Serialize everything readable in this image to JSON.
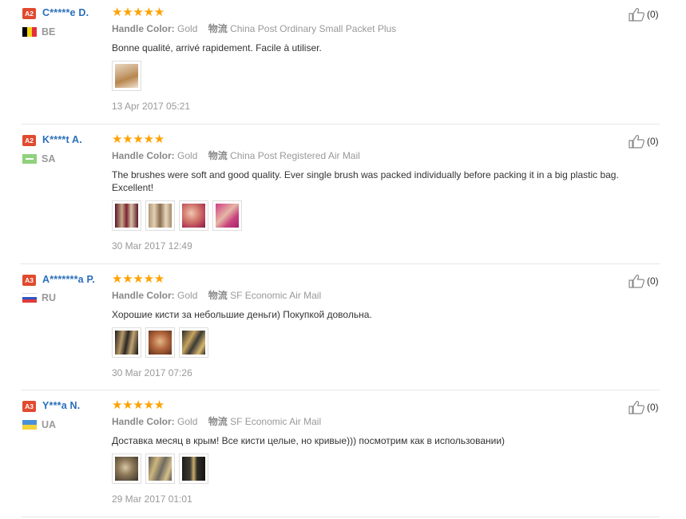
{
  "reviews": [
    {
      "level": "A2",
      "name": "C*****e D.",
      "country": "BE",
      "handle_label": "Handle Color:",
      "handle_value": "Gold",
      "ship_label": "物流",
      "ship_value": "China Post Ordinary Small Packet Plus",
      "text": "Bonne qualité, arrivé rapidement. Facile à utiliser.",
      "date": "13 Apr 2017 05:21",
      "likes": "(0)",
      "stars": 5,
      "photo_count": 1
    },
    {
      "level": "A2",
      "name": "K****t A.",
      "country": "SA",
      "handle_label": "Handle Color:",
      "handle_value": "Gold",
      "ship_label": "物流",
      "ship_value": "China Post Registered Air Mail",
      "text": "The brushes were soft and good quality. Ever single brush was packed individually before packing it in a big plastic bag. Excellent!",
      "date": "30 Mar 2017 12:49",
      "likes": "(0)",
      "stars": 5,
      "photo_count": 4
    },
    {
      "level": "A3",
      "name": "A*******a P.",
      "country": "RU",
      "handle_label": "Handle Color:",
      "handle_value": "Gold",
      "ship_label": "物流",
      "ship_value": "SF Economic Air Mail",
      "text": "Хорошие кисти за небольшие деньги) Покупкой довольна.",
      "date": "30 Mar 2017 07:26",
      "likes": "(0)",
      "stars": 5,
      "photo_count": 3
    },
    {
      "level": "A3",
      "name": "Y***a N.",
      "country": "UA",
      "handle_label": "Handle Color:",
      "handle_value": "Gold",
      "ship_label": "物流",
      "ship_value": "SF Economic Air Mail",
      "text": "Доставка месяц в крым! Все кисти целые, но кривые))) посмотрим как в использовании)",
      "date": "29 Mar 2017 01:01",
      "likes": "(0)",
      "stars": 5,
      "photo_count": 3
    }
  ],
  "colors": {
    "badge": "#e04a2f",
    "name": "#2a6ebb",
    "star": "#ffa200",
    "muted": "#999999"
  }
}
